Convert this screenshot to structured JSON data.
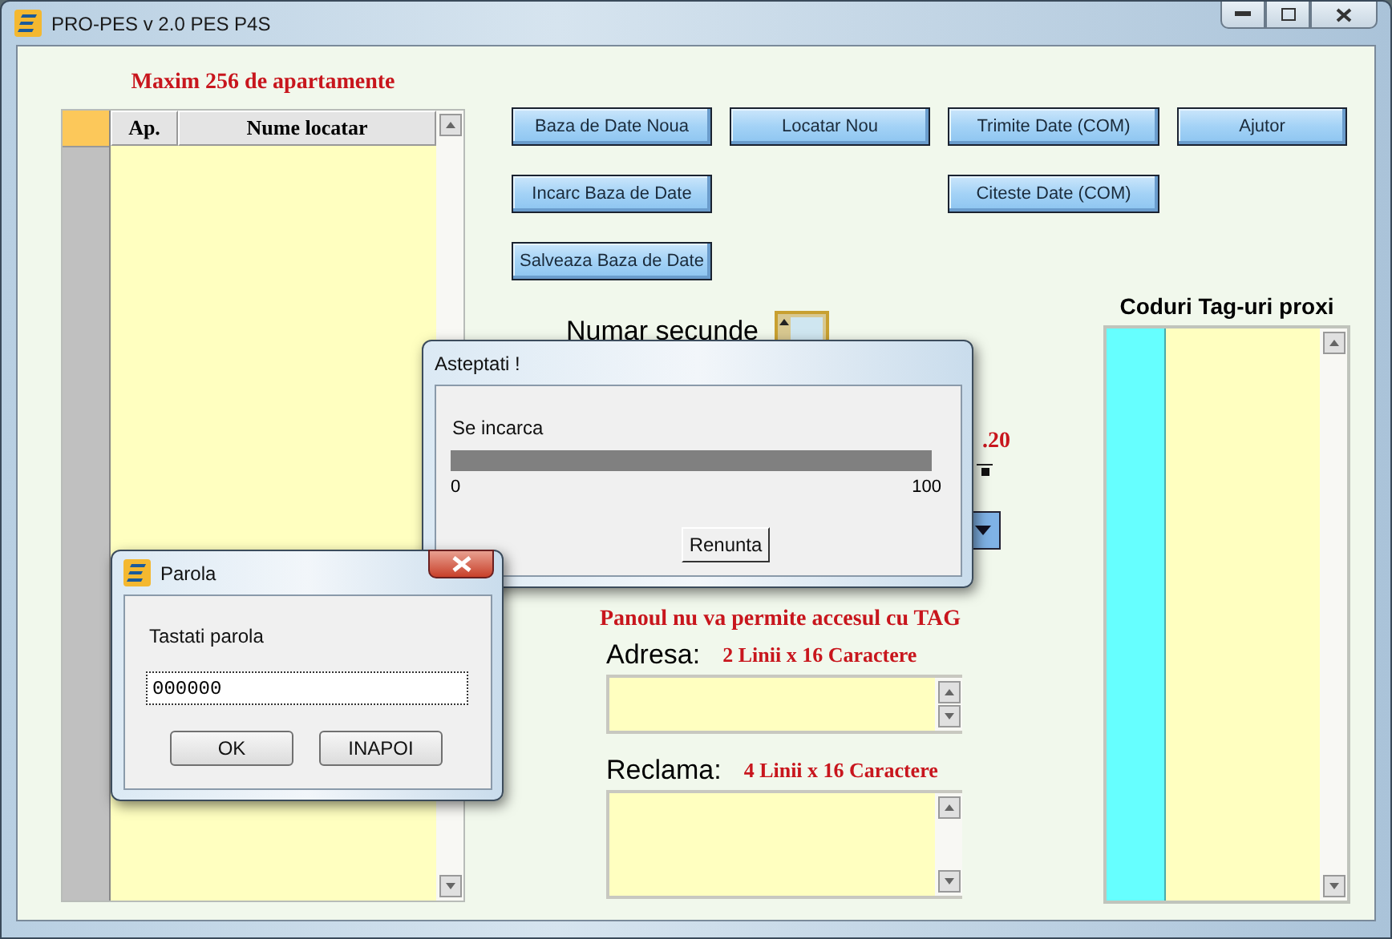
{
  "window": {
    "title": "PRO-PES v 2.0 PES P4S"
  },
  "apartments": {
    "caption": "Maxim 256 de apartamente",
    "columns": [
      "Ap.",
      "Nume locatar"
    ]
  },
  "button_rows": [
    [
      {
        "kind": "button",
        "label": "Baza de Date Noua"
      },
      {
        "kind": "button",
        "label": "Locatar Nou"
      },
      {
        "kind": "button",
        "label": "Trimite Date (COM)"
      },
      {
        "kind": "button",
        "label": "Ajutor"
      }
    ],
    [
      {
        "kind": "button",
        "label": "Incarc Baza de Date"
      },
      {
        "kind": "empty"
      },
      {
        "kind": "button",
        "label": "Citeste Date (COM)"
      }
    ],
    [
      {
        "kind": "button",
        "label": "Salveaza Baza de Date"
      }
    ]
  ],
  "timer": {
    "label": "Numar secunde",
    "value_fragment": ".20"
  },
  "access_note": "Panoul nu va permite accesul cu TAG",
  "address": {
    "label": "Adresa:",
    "hint": "2 Linii x 16 Caractere"
  },
  "advert": {
    "label": "Reclama:",
    "hint": "4 Linii x 16 Caractere"
  },
  "tags": {
    "title": "Coduri Tag-uri proxi"
  },
  "progress_dialog": {
    "title": "Asteptati !",
    "message": "Se incarca",
    "level": 1,
    "min_label": "0",
    "max_label": "100",
    "button": "Renunta"
  },
  "password_dialog": {
    "title": "Parola",
    "prompt": "Tastati parola",
    "value": "000000",
    "buttons": [
      "OK",
      "INAPOI"
    ]
  }
}
